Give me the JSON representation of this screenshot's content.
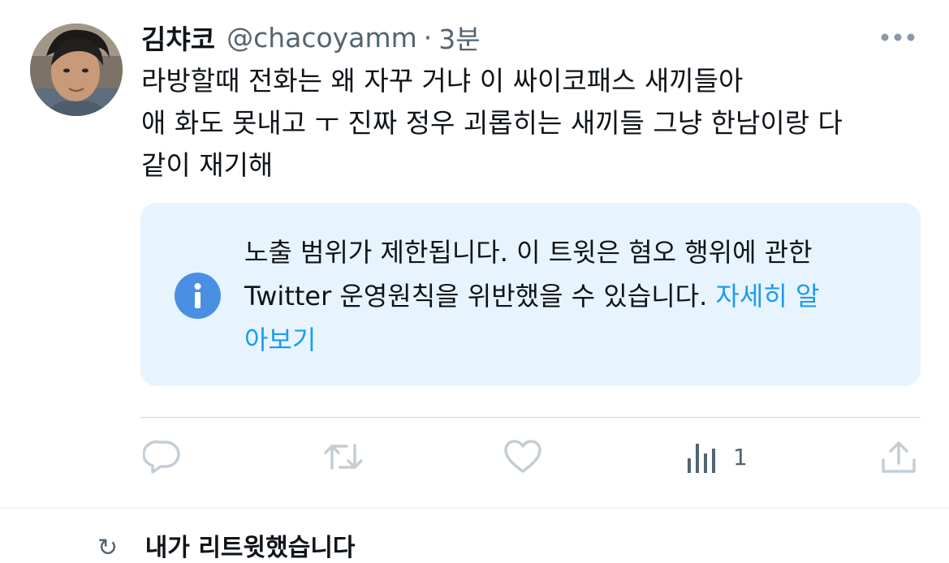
{
  "tweet": {
    "display_name": "김챠코",
    "handle": "@chacoyamm",
    "separator": "·",
    "time": "3분",
    "text_lines": [
      "라방할때 전화는 왜 자꾸 거냐 이 싸이코패스 새끼들아",
      "애 화도 못내고 ㅜ 진짜 정우 괴롭히는 새끼들 그냥 한남이랑 다",
      "같이 재기해"
    ],
    "more_icon": "more-horizontal-icon"
  },
  "notice": {
    "icon": "info-icon",
    "line1": "노출 범위가 제한됩니다. 이 트윗은 혐오 행위에 관한",
    "line2_text": "Twitter 운영원칙을 위반했을 수 있습니다. ",
    "line2_link": "자세히 알",
    "line3_link": "아보기",
    "link_color": "#1d9bf0"
  },
  "actions": {
    "reply_icon": "reply-icon",
    "retweet_icon": "retweet-icon",
    "like_icon": "heart-icon",
    "views_icon": "analytics-icon",
    "views_count": "1",
    "share_icon": "share-icon"
  },
  "next_tweet": {
    "partial_text": "내가 리트윗했습니다"
  },
  "colors": {
    "text": "#0f1419",
    "secondary": "#536471",
    "notice_bg": "#e8f4fd",
    "info_blue": "#4a90e2"
  }
}
